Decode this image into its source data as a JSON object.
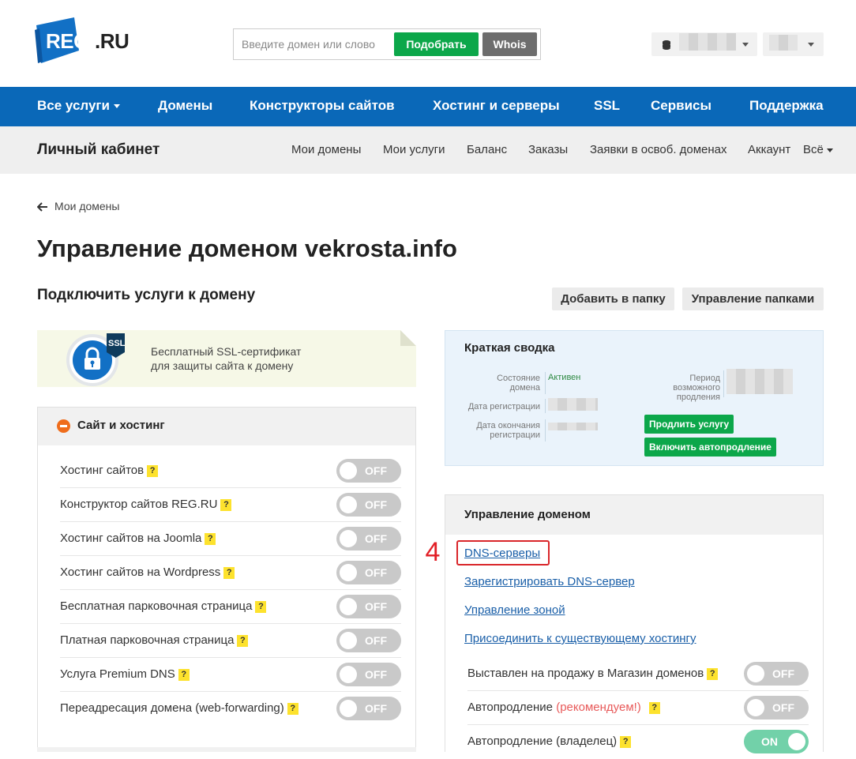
{
  "header": {
    "logo_text": "REG",
    "logo_suffix": ".RU",
    "search_placeholder": "Введите домен или слово",
    "pick_label": "Подобрать",
    "whois_label": "Whois"
  },
  "main_nav": [
    {
      "label": "Все услуги"
    },
    {
      "label": "Домены"
    },
    {
      "label": "Конструкторы сайтов"
    },
    {
      "label": "Хостинг и серверы"
    },
    {
      "label": "SSL"
    },
    {
      "label": "Сервисы"
    },
    {
      "label": "Поддержка"
    }
  ],
  "sub_nav": {
    "title": "Личный кабинет",
    "items": [
      "Мои домены",
      "Мои услуги",
      "Баланс",
      "Заказы",
      "Заявки в освоб. доменах",
      "Аккаунт",
      "Всё"
    ]
  },
  "breadcrumb": {
    "label": "Мои домены"
  },
  "page_title": "Управление доменом vekrosta.info",
  "services": {
    "title": "Подключить услуги к домену",
    "add_folder": "Добавить в папку",
    "manage_folders": "Управление папками"
  },
  "ssl_promo": {
    "badge": "SSL",
    "line1": "Бесплатный SSL-сертификат",
    "line2": "для защиты сайта к домену"
  },
  "hosting": {
    "title": "Сайт и хостинг",
    "help_mark": "?",
    "rows": [
      {
        "label": "Хостинг сайтов",
        "state": "OFF"
      },
      {
        "label": "Конструктор сайтов REG.RU",
        "state": "OFF"
      },
      {
        "label": "Хостинг сайтов на Joomla",
        "state": "OFF"
      },
      {
        "label": "Хостинг сайтов на Wordpress",
        "state": "OFF"
      },
      {
        "label": "Бесплатная парковочная страница",
        "state": "OFF"
      },
      {
        "label": "Платная парковочная страница",
        "state": "OFF"
      },
      {
        "label": "Услуга Premium DNS",
        "state": "OFF"
      },
      {
        "label": "Переадресация домена (web-forwarding)",
        "state": "OFF"
      }
    ]
  },
  "summary": {
    "title": "Краткая сводка",
    "status_key_1": "Состояние",
    "status_key_2": "домена",
    "status_value": "Активен",
    "reg_key": "Дата регистрации",
    "end_key_1": "Дата окончания",
    "end_key_2": "регистрации",
    "period_key_1": "Период",
    "period_key_2": "возможного",
    "period_key_3": "продления",
    "renew_button": "Продлить услугу",
    "autorenew_button": "Включить автопродление"
  },
  "domain_manage": {
    "title": "Управление доменом",
    "step_number": "4",
    "links": [
      "DNS-серверы",
      "Зарегистрировать DNS-сервер",
      "Управление зоной",
      "Присоединить к существующему хостингу"
    ],
    "options": [
      {
        "label": "Выставлен на продажу в Магазин доменов",
        "state": "OFF"
      },
      {
        "label": "Автопродление",
        "note": "(рекомендуем!)",
        "state": "OFF"
      },
      {
        "label": "Автопродление (владелец)",
        "state": "ON"
      }
    ]
  },
  "colors": {
    "nav_blue": "#0a68b8",
    "green": "#0ca74a",
    "highlight_red": "#d9262a",
    "toggle_on": "#72d1a9"
  }
}
